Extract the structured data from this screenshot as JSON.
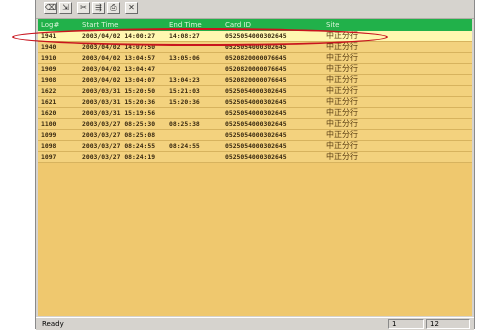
{
  "toolbar": {
    "icons": [
      "delete-record-icon",
      "export-icon",
      "cut-icon",
      "jump-icon",
      "print-icon",
      "close-icon"
    ],
    "glyphs": [
      "⌫",
      "⇲",
      "✂",
      "⇶",
      "⎙",
      "✕"
    ]
  },
  "table": {
    "columns": [
      "Log#",
      "Start Time",
      "End Time",
      "Card ID",
      "Site"
    ],
    "rows": [
      {
        "log": "1941",
        "start": "2003/04/02 14:00:27",
        "end": "14:08:27",
        "card": "0525054000302645",
        "site": "中正分行"
      },
      {
        "log": "1940",
        "start": "2003/04/02 14:07:50",
        "end": "",
        "card": "0525054000302645",
        "site": "中正分行"
      },
      {
        "log": "1910",
        "start": "2003/04/02 13:04:57",
        "end": "13:05:06",
        "card": "0520820000076645",
        "site": "中正分行"
      },
      {
        "log": "1909",
        "start": "2003/04/02 13:04:47",
        "end": "",
        "card": "0520820000076645",
        "site": "中正分行"
      },
      {
        "log": "1908",
        "start": "2003/04/02 13:04:07",
        "end": "13:04:23",
        "card": "0520820000076645",
        "site": "中正分行"
      },
      {
        "log": "1622",
        "start": "2003/03/31 15:20:50",
        "end": "15:21:03",
        "card": "0525054000302645",
        "site": "中正分行"
      },
      {
        "log": "1621",
        "start": "2003/03/31 15:20:36",
        "end": "15:20:36",
        "card": "0525054000302645",
        "site": "中正分行"
      },
      {
        "log": "1620",
        "start": "2003/03/31 15:19:56",
        "end": "",
        "card": "0525054000302645",
        "site": "中正分行"
      },
      {
        "log": "1100",
        "start": "2003/03/27 08:25:30",
        "end": "08:25:38",
        "card": "0525054000302645",
        "site": "中正分行"
      },
      {
        "log": "1099",
        "start": "2003/03/27 08:25:08",
        "end": "",
        "card": "0525054000302645",
        "site": "中正分行"
      },
      {
        "log": "1098",
        "start": "2003/03/27 08:24:55",
        "end": "08:24:55",
        "card": "0525054000302645",
        "site": "中正分行"
      },
      {
        "log": "1097",
        "start": "2003/03/27 08:24:19",
        "end": "",
        "card": "0525054000302645",
        "site": "中正分行"
      }
    ],
    "selected_index": 0
  },
  "status": {
    "text": "Ready",
    "pane1": "1",
    "pane2": "12"
  },
  "colors": {
    "header_bg": "#21b14a",
    "row_bg": "#f3d27e",
    "selected_row_bg": "#fff7b0",
    "highlight_ring": "#c8141e"
  }
}
